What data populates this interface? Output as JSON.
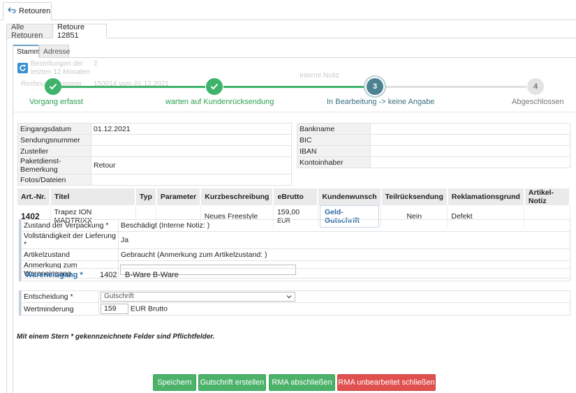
{
  "top_tab": {
    "label": "Retouren"
  },
  "record_tabs": [
    {
      "label": "Alle Retouren"
    },
    {
      "label": "Retoure 12851"
    }
  ],
  "sub_tabs": [
    {
      "label": "Stamm"
    },
    {
      "label": "Adresse"
    }
  ],
  "ghost": {
    "line1": "Bestellungen der",
    "line1_value": "2",
    "line2": "letzten 12 Monaten",
    "line3": "Rechnungsnummer",
    "line3_value": "150014 vom 01.12.2021",
    "right": "Interne Notiz"
  },
  "stepper": {
    "steps": [
      {
        "number": "✓",
        "label": "Vorgang erfasst",
        "state": "done"
      },
      {
        "number": "✓",
        "label": "warten auf Kundenrücksendung",
        "state": "done"
      },
      {
        "number": "3",
        "label": "In Bearbeitung -> keine Angabe",
        "state": "active"
      },
      {
        "number": "4",
        "label": "Abgeschlossen",
        "state": "todo"
      }
    ],
    "colors": {
      "done": "#3fb36b",
      "active": "#4b8191",
      "todo": "#e3e3e3",
      "done_label": "#2e9e4f",
      "active_label": "#3a7180"
    }
  },
  "left_info": [
    {
      "label": "Eingangsdatum",
      "value": "01.12.2021"
    },
    {
      "label": "Sendungsnummer",
      "value": ""
    },
    {
      "label": "Zusteller",
      "value": ""
    },
    {
      "label": "Paketdienst-Bemerkung",
      "value": "Retour"
    },
    {
      "label": "Fotos/Dateien",
      "value": ""
    }
  ],
  "right_info": [
    {
      "label": "Bankname",
      "value": ""
    },
    {
      "label": "BIC",
      "value": ""
    },
    {
      "label": "IBAN",
      "value": ""
    },
    {
      "label": "Kontoinhaber",
      "value": ""
    }
  ],
  "article_table": {
    "headers": [
      "Art.-Nr.",
      "Titel",
      "Typ",
      "Parameter",
      "Kurzbeschreibung",
      "eBrutto",
      "Kundenwunsch",
      "Teilrücksendung",
      "Reklamationsgrund",
      "Artikel-Notiz"
    ],
    "row": {
      "art_nr": "1402",
      "titel": "Trapez ION MADTRIXX",
      "typ": "",
      "parameter": "",
      "kurzbeschreibung": "Neues Freestyle",
      "ebrutto": "159,00",
      "currency": "EUR",
      "kundenwunsch": "Geld-Gutschrift",
      "teilruecksendung": "Nein",
      "reklamationsgrund": "Defekt",
      "artikel_notiz": ""
    }
  },
  "details": {
    "verpackung": {
      "label": "Zustand der Verpackung *",
      "value": "Beschädigt (Interne Notiz: )"
    },
    "lieferung": {
      "label": "Vollständigkeit der Lieferung *",
      "value": "Ja"
    },
    "artikelzustand": {
      "label": "Artikelzustand",
      "value": "Gebraucht (Anmerkung zum Artikelzustand: )"
    },
    "anmerkung": {
      "label": "Anmerkung zum Wareneingang",
      "value": ""
    },
    "wareneingang": {
      "label": "Wareneingang *",
      "nr": "1402",
      "value": "B-Ware B-Ware"
    }
  },
  "decision": {
    "entscheidung": {
      "label": "Entscheidung *",
      "value": "Gutschrift"
    },
    "wertminderung": {
      "label": "Wertminderung",
      "value": "159",
      "unit": "EUR Brutto"
    }
  },
  "hint": "Mit einem Stern * gekennzeichnete Felder sind Pflichtfelder.",
  "buttons": {
    "save": "Speichern",
    "credit": "Gutschrift erstellen",
    "close_rma": "RMA abschließen",
    "close_unprocessed": "RMA unbearbeitet schließen"
  }
}
